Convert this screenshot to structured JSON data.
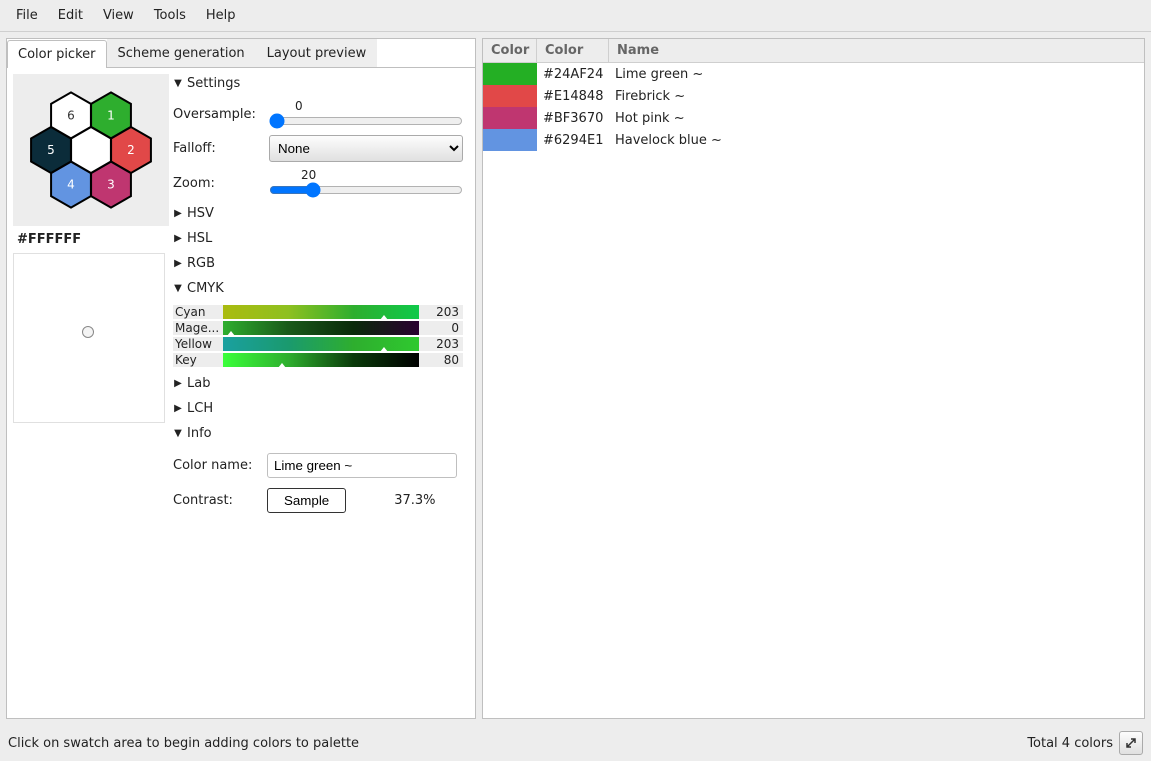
{
  "menu": {
    "items": [
      "File",
      "Edit",
      "View",
      "Tools",
      "Help"
    ]
  },
  "tabs": [
    "Color picker",
    "Scheme generation",
    "Layout preview"
  ],
  "active_tab": 0,
  "current_hex": "#FFFFFF",
  "hexagon": {
    "cells": [
      {
        "n": 1,
        "fill": "#2EAE2E"
      },
      {
        "n": 2,
        "fill": "#E14848"
      },
      {
        "n": 3,
        "fill": "#BF3670"
      },
      {
        "n": 4,
        "fill": "#6294E1"
      },
      {
        "n": 5,
        "fill": "#0B2C3A"
      },
      {
        "n": 6,
        "fill": "#FFFFFF"
      }
    ],
    "center_fill": "#FFFFFF"
  },
  "settings": {
    "title": "Settings",
    "oversample": {
      "label": "Oversample:",
      "value": 0,
      "min": 0,
      "max": 100
    },
    "falloff": {
      "label": "Falloff:",
      "value": "None",
      "options": [
        "None"
      ]
    },
    "zoom": {
      "label": "Zoom:",
      "value": 20,
      "min": 0,
      "max": 100
    }
  },
  "color_sections": {
    "hsv": "HSV",
    "hsl": "HSL",
    "rgb": "RGB",
    "cmyk": "CMYK",
    "lab": "Lab",
    "lch": "LCH",
    "info": "Info"
  },
  "cmyk": {
    "channels": [
      {
        "label": "Cyan",
        "value": 203,
        "grad": "linear-gradient(to right,#aabb10,#8ec020,#2EAE2E,#0fc94a)",
        "ptr": 80
      },
      {
        "label": "Mage...",
        "value": 0,
        "grad": "linear-gradient(to right,#2EAE2E,#1a5a1a,#0a2a0a,#2a0030)",
        "ptr": 2
      },
      {
        "label": "Yellow",
        "value": 203,
        "grad": "linear-gradient(to right,#1aa0a0,#1a9a6e,#2EAE2E,#2fc92f)",
        "ptr": 80
      },
      {
        "label": "Key",
        "value": 80,
        "grad": "linear-gradient(to right,#3aff3a,#2EAE2E,#0a3a0a,#000000)",
        "ptr": 28
      }
    ]
  },
  "info": {
    "colorname_label": "Color name:",
    "colorname_value": "Lime green ~",
    "contrast_label": "Contrast:",
    "sample_label": "Sample",
    "contrast_value": "37.3%"
  },
  "palette": {
    "headers": [
      "Color",
      "Color",
      "Name"
    ],
    "rows": [
      {
        "hex": "#24AF24",
        "name": "Lime green ~"
      },
      {
        "hex": "#E14848",
        "name": "Firebrick ~"
      },
      {
        "hex": "#BF3670",
        "name": "Hot pink ~"
      },
      {
        "hex": "#6294E1",
        "name": "Havelock blue ~"
      }
    ]
  },
  "status": {
    "left": "Click on swatch area to begin adding colors to palette",
    "right": "Total 4 colors"
  }
}
